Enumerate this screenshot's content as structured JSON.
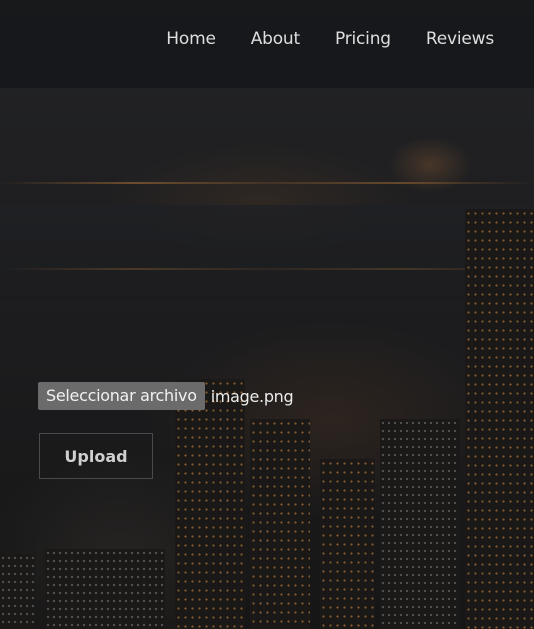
{
  "nav": {
    "items": [
      {
        "label": "Home"
      },
      {
        "label": "About"
      },
      {
        "label": "Pricing"
      },
      {
        "label": "Reviews"
      }
    ]
  },
  "upload_form": {
    "choose_file_label": "Seleccionar archivo",
    "file_name": "image.png",
    "submit_label": "Upload"
  },
  "colors": {
    "overlay": "#1c1c1e",
    "nav_text": "#dedede",
    "file_button_bg": "#6b6b6b",
    "upload_border": "#4a4a4a"
  }
}
